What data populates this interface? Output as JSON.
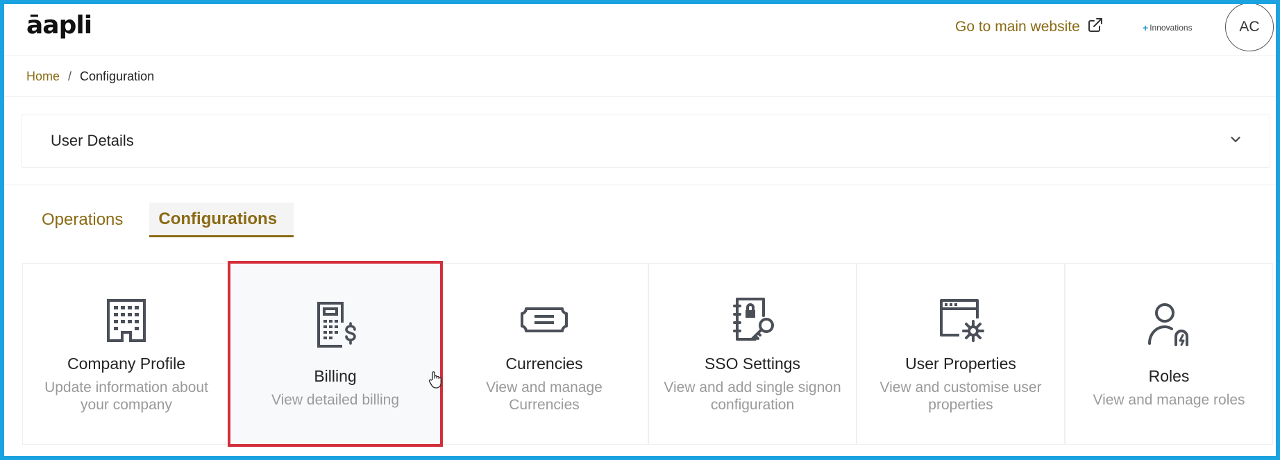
{
  "header": {
    "logo": "āapli",
    "main_link": "Go to main website",
    "innovations": "Innovations",
    "avatar": "AC"
  },
  "breadcrumb": {
    "home": "Home",
    "separator": "/",
    "current": "Configuration"
  },
  "accordion": {
    "title": "User Details"
  },
  "tabs": [
    {
      "label": "Operations",
      "active": false
    },
    {
      "label": "Configurations",
      "active": true
    }
  ],
  "cards": [
    {
      "name": "Company Profile",
      "desc": "Update information about your company",
      "icon": "building-icon"
    },
    {
      "name": "Billing",
      "desc": "View detailed billing",
      "icon": "calculator-dollar-icon"
    },
    {
      "name": "Currencies",
      "desc": "View and manage Currencies",
      "icon": "banknote-icon"
    },
    {
      "name": "SSO Settings",
      "desc": "View and add single signon configuration",
      "icon": "notebook-key-icon"
    },
    {
      "name": "User Properties",
      "desc": "View and customise user properties",
      "icon": "window-gear-icon"
    },
    {
      "name": "Roles",
      "desc": "View and manage roles",
      "icon": "user-lock-icon"
    }
  ],
  "colors": {
    "accent": "#8a6a14",
    "frame": "#1aa3e0",
    "highlight": "#d32f3b",
    "icon": "#4a4f58"
  }
}
